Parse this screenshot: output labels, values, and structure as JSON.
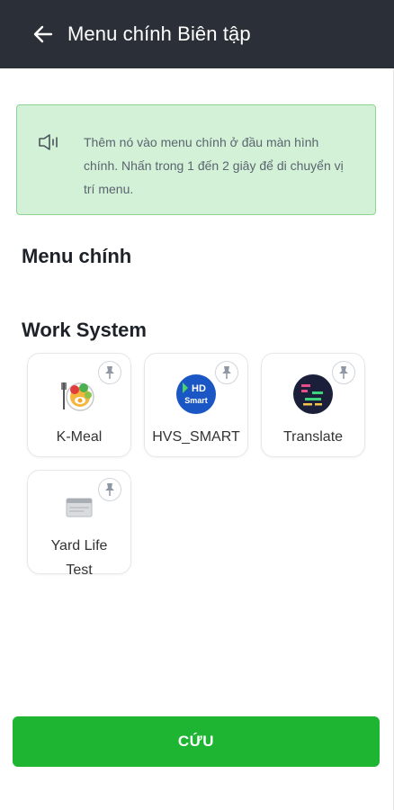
{
  "header": {
    "title": "Menu chính Biên tập",
    "back_icon": "arrow-left-icon"
  },
  "notice": {
    "icon": "speaker-icon",
    "text": "Thêm nó vào menu chính ở đầu màn hình chính. Nhấn trong 1 đến 2 giây để di chuyển vị trí menu."
  },
  "main_menu": {
    "title": "Menu chính"
  },
  "work_system": {
    "title": "Work System",
    "apps": [
      {
        "label": "K-Meal",
        "icon": "kmeal-food-icon",
        "pin_icon": "pin-icon"
      },
      {
        "label": "HVS_SMART",
        "icon": "hd-smart-icon",
        "pin_icon": "pin-icon"
      },
      {
        "label": "Translate",
        "icon": "translate-icon",
        "pin_icon": "pin-icon"
      },
      {
        "label": "Yard Life Test",
        "icon": "browser-window-icon",
        "pin_icon": "pin-icon"
      }
    ]
  },
  "footer": {
    "save_label": "CỨU"
  },
  "colors": {
    "header_bg": "#2b3038",
    "notice_bg": "#d3f1d6",
    "save_bg": "#1eb532"
  }
}
